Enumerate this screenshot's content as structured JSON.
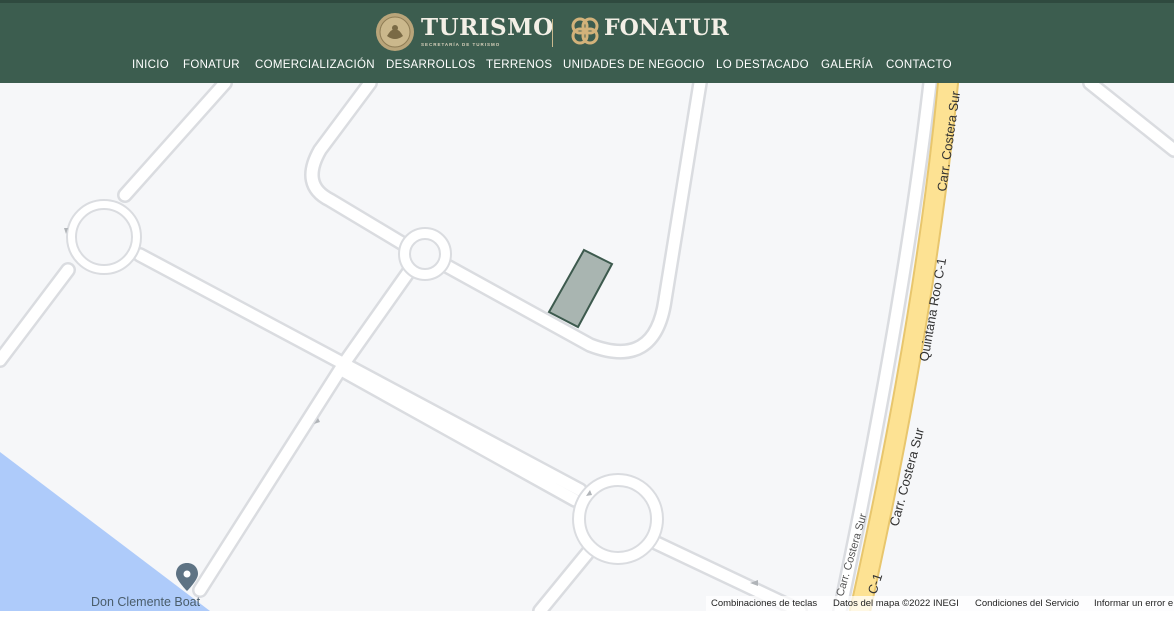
{
  "header": {
    "turismo_wordmark": "TURISMO",
    "turismo_subline": "SECRETARÍA DE TURISMO",
    "fonatur_wordmark": "FONATUR",
    "background_color": "#3c5d4f"
  },
  "nav": {
    "items": [
      {
        "label": "INICIO"
      },
      {
        "label": "FONATUR"
      },
      {
        "label": "COMERCIALIZACIÓN"
      },
      {
        "label": "DESARROLLOS"
      },
      {
        "label": "TERRENOS"
      },
      {
        "label": "UNIDADES DE NEGOCIO"
      },
      {
        "label": "LO DESTACADO"
      },
      {
        "label": "GALERÍA"
      },
      {
        "label": "CONTACTO"
      }
    ]
  },
  "map": {
    "road_labels": {
      "highway_1": "Carr. Costera Sur",
      "highway_2": "Quintana Roo C-1",
      "highway_3": "Carr. Costera Sur",
      "highway_4": "C-1",
      "side_road": "Carr. Costera Sur"
    },
    "place_marker_label": "Don Clemente Boat",
    "colors": {
      "land": "#f6f7f9",
      "water": "#aecbfa",
      "road": "#ffffff",
      "road_casing": "#dadce0",
      "highway": "#fde293",
      "parcel_fill": "#a9b5b1",
      "parcel_stroke": "#3d5a4e"
    }
  },
  "attribution": {
    "shortcuts": "Combinaciones de teclas",
    "map_data": "Datos del mapa ©2022 INEGI",
    "terms": "Condiciones del Servicio",
    "report": "Informar un error e"
  }
}
